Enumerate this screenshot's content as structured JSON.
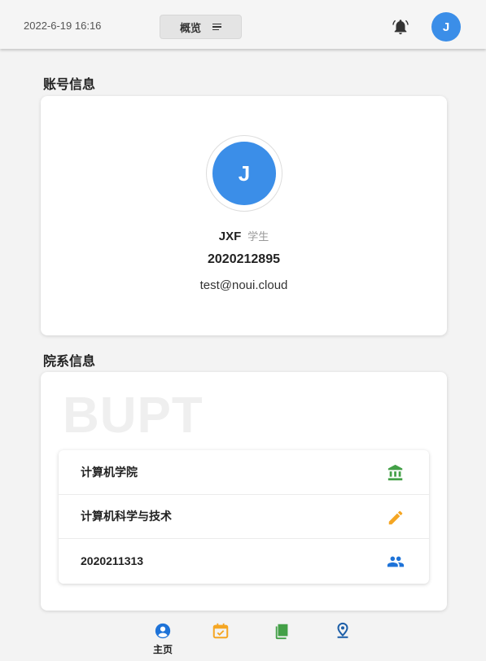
{
  "header": {
    "datetime": "2022-6-19 16:16",
    "overview_label": "概览",
    "avatar_initial": "J"
  },
  "account": {
    "section_title": "账号信息",
    "avatar_initial": "J",
    "name": "JXF",
    "role": "学生",
    "student_id": "2020212895",
    "email": "test@noui.cloud"
  },
  "department": {
    "section_title": "院系信息",
    "watermark": "BUPT",
    "rows": [
      {
        "label": "计算机学院",
        "icon": "institution-icon",
        "color": "#43a047"
      },
      {
        "label": "计算机科学与技术",
        "icon": "pencil-icon",
        "color": "#f5a623"
      },
      {
        "label": "2020211313",
        "icon": "group-icon",
        "color": "#1e73d8"
      }
    ]
  },
  "bottom_nav": {
    "items": [
      {
        "name": "home",
        "label": "主页",
        "icon": "account-circle-icon",
        "color": "#1e73d8"
      },
      {
        "name": "schedule",
        "label": "",
        "icon": "calendar-check-icon",
        "color": "#f5a623"
      },
      {
        "name": "courses",
        "label": "",
        "icon": "book-icon",
        "color": "#43a047"
      },
      {
        "name": "location",
        "label": "",
        "icon": "map-pin-icon",
        "color": "#1e5fa8"
      }
    ]
  },
  "colors": {
    "accent": "#3b8ee8",
    "background": "#f3f3f3"
  }
}
